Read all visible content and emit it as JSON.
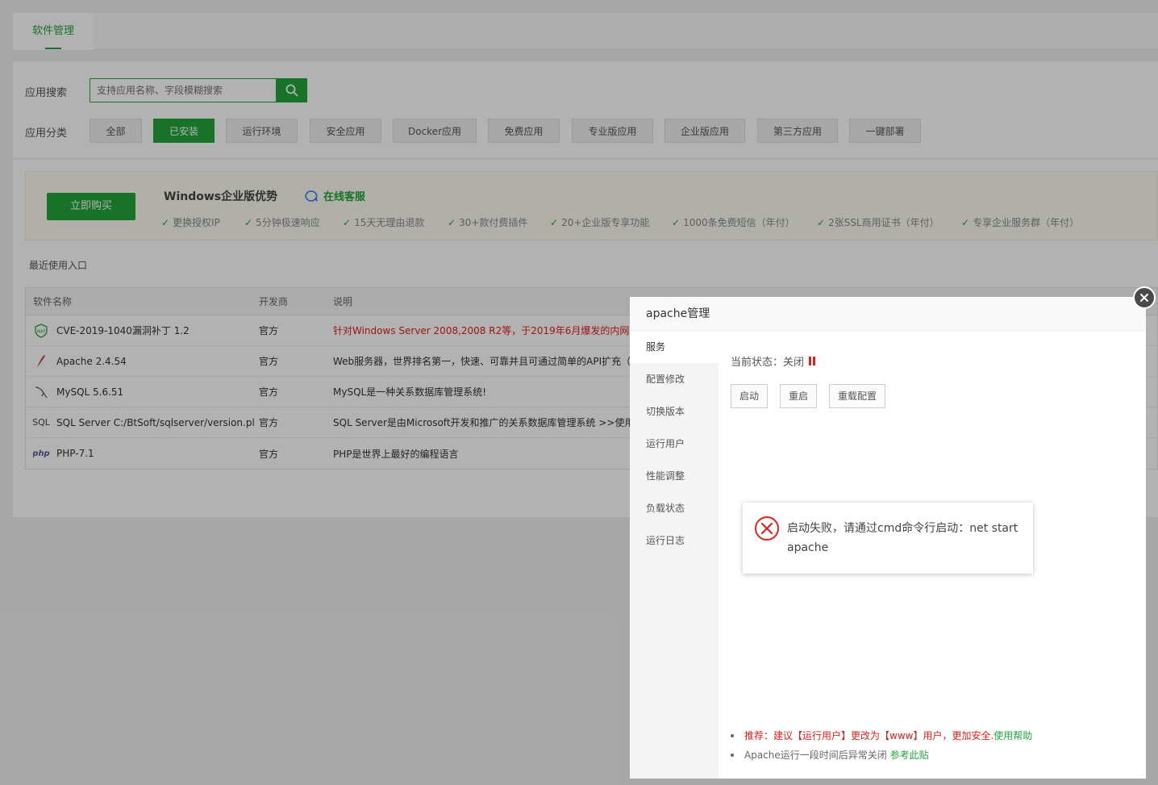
{
  "tabs": [
    {
      "label": "软件管理"
    }
  ],
  "search": {
    "label": "应用搜索",
    "placeholder": "支持应用名称、字段模糊搜索"
  },
  "category": {
    "label": "应用分类",
    "items": [
      "全部",
      "已安装",
      "运行环境",
      "安全应用",
      "Docker应用",
      "免费应用",
      "专业版应用",
      "企业版应用",
      "第三方应用",
      "一键部署"
    ],
    "active": "已安装"
  },
  "promo": {
    "buy_label": "立即购买",
    "title": "Windows企业版优势",
    "kefu": "在线客服",
    "features": [
      "更换授权IP",
      "5分钟极速响应",
      "15天无理由退款",
      "30+款付费插件",
      "20+企业版专享功能",
      "1000条免费短信（年付）",
      "2张SSL商用证书（年付）",
      "专享企业服务群（年付）"
    ]
  },
  "recent": {
    "label": "最近使用入口"
  },
  "table": {
    "headers": [
      "软件名称",
      "开发商",
      "说明"
    ],
    "rows": [
      {
        "icon": "waf-shield-icon",
        "name": "CVE-2019-1040漏洞补丁 1.2",
        "vendor": "官方",
        "desc": "针对Windows Server 2008,2008 R2等，于2019年6月爆发的内网大"
      },
      {
        "icon": "apache-feather-icon",
        "name": "Apache 2.4.54",
        "vendor": "官方",
        "desc": "Web服务器，世界排名第一，快速、可靠并且可通过简单的API扩充（"
      },
      {
        "icon": "mysql-dolphin-icon",
        "name": "MySQL 5.6.51",
        "vendor": "官方",
        "desc": "MySQL是一种关系数据库管理系统!"
      },
      {
        "icon": "sql-text-icon",
        "name": "SQL Server C:/BtSoft/sqlserver/version.pl",
        "vendor": "官方",
        "desc": "SQL Server是由Microsoft开发和推广的关系数据库管理系统 >>使用"
      },
      {
        "icon": "php-text-icon",
        "name": "PHP-7.1",
        "vendor": "官方",
        "desc": "PHP是世界上最好的编程语言"
      }
    ],
    "sql_icon_text": "SQL",
    "php_icon_text": "php",
    "waf_icon_text": "WAF"
  },
  "modal": {
    "title": "apache管理",
    "menu": [
      "服务",
      "配置修改",
      "切换版本",
      "运行用户",
      "性能调整",
      "负载状态",
      "运行日志"
    ],
    "active_menu": "服务",
    "status_label": "当前状态：关闭",
    "buttons": [
      "启动",
      "重启",
      "重载配置"
    ],
    "tips": {
      "tip1_red": "推荐：建议【运行用户】更改为【www】用户，更加安全.",
      "tip1_link": "使用帮助",
      "tip2_text": "Apache运行一段时间后异常关闭",
      "tip2_link": "参考此贴"
    }
  },
  "toast": {
    "message": "启动失败，请通过cmd命令行启动：net start apache"
  },
  "colors": {
    "primary": "#20a53a",
    "danger": "#e0211b"
  }
}
